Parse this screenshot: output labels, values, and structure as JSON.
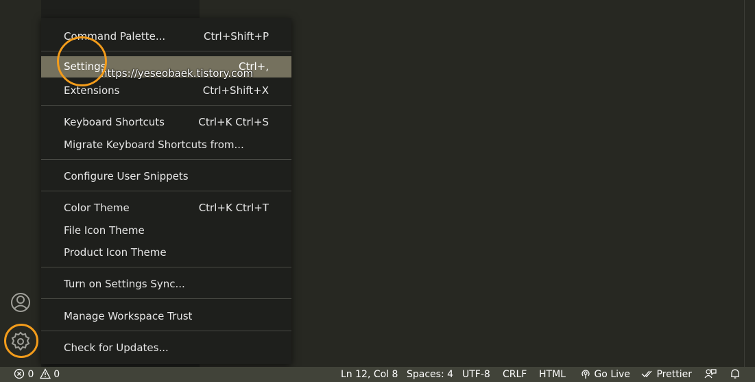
{
  "menu": {
    "items": [
      {
        "label": "Command Palette...",
        "shortcut": "Ctrl+Shift+P"
      },
      {
        "label": "Settings",
        "shortcut": "Ctrl+,"
      },
      {
        "label": "Extensions",
        "shortcut": "Ctrl+Shift+X"
      },
      {
        "label": "Keyboard Shortcuts",
        "shortcut": "Ctrl+K Ctrl+S"
      },
      {
        "label": "Migrate Keyboard Shortcuts from...",
        "shortcut": ""
      },
      {
        "label": "Configure User Snippets",
        "shortcut": ""
      },
      {
        "label": "Color Theme",
        "shortcut": "Ctrl+K Ctrl+T"
      },
      {
        "label": "File Icon Theme",
        "shortcut": ""
      },
      {
        "label": "Product Icon Theme",
        "shortcut": ""
      },
      {
        "label": "Turn on Settings Sync...",
        "shortcut": ""
      },
      {
        "label": "Manage Workspace Trust",
        "shortcut": ""
      },
      {
        "label": "Check for Updates...",
        "shortcut": ""
      }
    ]
  },
  "watermark": "https://yeseobaek.tistory.com",
  "activity_bar": {
    "icons": [
      "account-icon",
      "gear-icon"
    ]
  },
  "statusbar": {
    "errors": "0",
    "warnings": "0",
    "position": "Ln 12, Col 8",
    "spaces": "Spaces: 4",
    "encoding": "UTF-8",
    "eol": "CRLF",
    "language": "HTML",
    "go_live": "Go Live",
    "prettier": "Prettier"
  },
  "colors": {
    "editor_bg": "#272822",
    "menu_bg": "#1e1f1c",
    "active_item": "#75715e",
    "statusbar_bg": "#414339",
    "highlight_circle": "#f39c1b"
  }
}
